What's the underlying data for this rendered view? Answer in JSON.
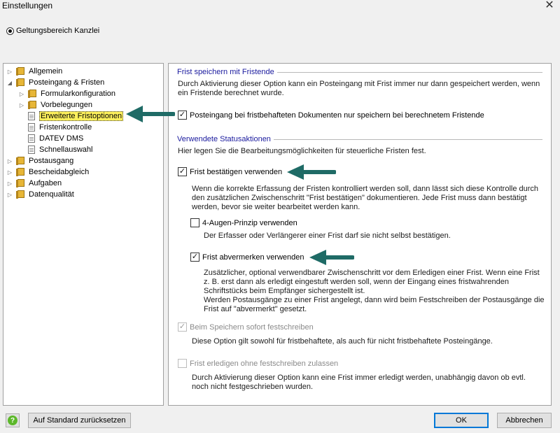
{
  "window": {
    "title": "Einstellungen",
    "close_glyph": "✕"
  },
  "scope": {
    "label": "Geltungsbereich Kanzlei",
    "selected": true
  },
  "tree": {
    "items": [
      {
        "label": "Allgemein",
        "icon": "folder-icon",
        "toggle": "▷"
      },
      {
        "label": "Posteingang & Fristen",
        "icon": "folder-icon",
        "toggle": "◢"
      },
      {
        "label": "Formularkonfiguration",
        "icon": "folder-icon",
        "toggle": "▷"
      },
      {
        "label": "Vorbelegungen",
        "icon": "folder-icon",
        "toggle": "▷"
      },
      {
        "label": "Erweiterte Fristoptionen",
        "icon": "page-icon",
        "selected": true
      },
      {
        "label": "Fristenkontrolle",
        "icon": "page-icon"
      },
      {
        "label": "DATEV DMS",
        "icon": "page-icon"
      },
      {
        "label": "Schnellauswahl",
        "icon": "page-icon"
      },
      {
        "label": "Postausgang",
        "icon": "folder-icon",
        "toggle": "▷"
      },
      {
        "label": "Bescheidabgleich",
        "icon": "folder-icon",
        "toggle": "▷"
      },
      {
        "label": "Aufgaben",
        "icon": "folder-icon",
        "toggle": "▷"
      },
      {
        "label": "Datenqualität",
        "icon": "folder-icon",
        "toggle": "▷"
      }
    ]
  },
  "section1": {
    "title": "Frist speichern mit Fristende",
    "description": "Durch Aktivierung dieser Option kann ein Posteingang mit Frist immer nur dann gespeichert werden, wenn ein Fristende berechnet wurde.",
    "checkbox_label": "Posteingang bei fristbehafteten Dokumenten nur speichern bei berechnetem Fristende",
    "checkbox_checked": true
  },
  "section2": {
    "title": "Verwendete Statusaktionen",
    "intro": "Hier legen Sie die Bearbeitungsmöglichkeiten für steuerliche Fristen fest.",
    "confirm": {
      "label": "Frist bestätigen verwenden",
      "checked": true,
      "description": "Wenn die korrekte Erfassung der Fristen kontrolliert werden soll, dann lässt sich diese Kontrolle durch den zusätzlichen Zwischenschritt \"Frist bestätigen\" dokumentieren. Jede Frist muss dann bestätigt werden, bevor sie weiter bearbeitet werden kann."
    },
    "four_eyes": {
      "label": "4-Augen-Prinzip verwenden",
      "checked": false,
      "description": "Der Erfasser oder Verlängerer einer Frist darf sie nicht selbst bestätigen."
    },
    "mark": {
      "label": "Frist abvermerken verwenden",
      "checked": true,
      "description1": "Zusätzlicher, optional verwendbarer Zwischenschritt vor dem Erledigen einer Frist. Wenn eine Frist z. B. erst dann als erledigt eingestuft werden soll, wenn der Eingang eines fristwahrenden Schriftstücks beim Empfänger sichergestellt ist.",
      "description2": "Werden Postausgänge zu einer Frist angelegt, dann wird beim Festschreiben der Postausgänge die Frist auf \"abvermerkt\" gesetzt."
    },
    "fix_on_save": {
      "label": "Beim Speichern sofort festschreiben",
      "checked": true,
      "disabled": true,
      "description": "Diese Option gilt sowohl für fristbehaftete, als auch für nicht fristbehaftete Posteingänge."
    },
    "complete_without_fix": {
      "label": "Frist erledigen ohne festschreiben zulassen",
      "checked": false,
      "disabled": true,
      "description": "Durch Aktivierung dieser Option kann eine Frist immer erledigt werden, unabhängig davon ob evtl. noch nicht festgeschrieben wurden."
    }
  },
  "footer": {
    "help_glyph": "?",
    "reset_label": "Auf Standard zurücksetzen",
    "ok_label": "OK",
    "cancel_label": "Abbrechen"
  },
  "colors": {
    "group_title": "#1a1a9e",
    "selection": "#fdf05c",
    "arrow": "#1f6b66",
    "folder": "#e7b637"
  },
  "check_glyph": "✓"
}
